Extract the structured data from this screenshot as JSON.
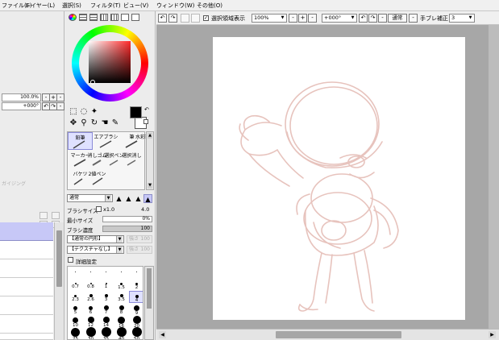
{
  "menubar": {
    "items": [
      "ファイル(F)",
      "レイヤー(L)",
      "選択(S)",
      "フィルタ(T)",
      "ビュー(V)",
      "ウィンドウ(W)",
      "その他(O)"
    ]
  },
  "left_panel": {
    "field_value_1": "100.0%",
    "field_value_2": "+000°",
    "faded_label": "ガイジング",
    "btn_minus": "-",
    "btn_plus": "+",
    "btn_reset": "-",
    "btn_rot_left": "↶",
    "btn_rot_right": "↷"
  },
  "tool_panel": {
    "main_color": "#000000",
    "sub_color": "#ffffff",
    "brush_tools": [
      {
        "label": "鉛筆",
        "selected": true
      },
      {
        "label": "エアブラシ",
        "selected": false
      },
      {
        "label": "筆",
        "selected": false
      },
      {
        "label": "水彩筆",
        "selected": false
      },
      {
        "label": "マーカー",
        "selected": false
      },
      {
        "label": "消しゴム",
        "selected": false
      },
      {
        "label": "選択ペン",
        "selected": false
      },
      {
        "label": "選択消し",
        "selected": false
      },
      {
        "label": "バケツ",
        "selected": false
      },
      {
        "label": "2値ペン",
        "selected": false
      }
    ],
    "blend_mode": "通常",
    "brush_size_label": "ブラシサイズ",
    "brush_size_multiplier": "x1.0",
    "brush_size_value": "4.0",
    "min_size_label": "最小サイズ",
    "min_size_value": "0%",
    "density_label": "ブラシ濃度",
    "density_value": "100",
    "density_fraction": 1.0,
    "shape_dropdown": "【通常の円形】",
    "texture_dropdown": "【テクスチャなし】",
    "strength_1": "100",
    "strength_2": "100",
    "strength_label": "強さ",
    "detail_label": "詳細設定",
    "preset_sizes": [
      {
        "label": ".",
        "row": 0
      },
      {
        "label": ".",
        "row": 0
      },
      {
        "label": ".",
        "row": 0
      },
      {
        "label": ".",
        "row": 0
      },
      {
        "label": ".",
        "row": 0
      },
      {
        "label": "0.7",
        "row": 1
      },
      {
        "label": "0.8",
        "row": 1
      },
      {
        "label": "1",
        "row": 1
      },
      {
        "label": "1.5",
        "row": 1
      },
      {
        "label": "2",
        "row": 1
      },
      {
        "label": "2.3",
        "row": 2
      },
      {
        "label": "2.6",
        "row": 2
      },
      {
        "label": "3",
        "row": 2
      },
      {
        "label": "3.5",
        "row": 2
      },
      {
        "label": "4",
        "row": 2
      },
      {
        "label": "5",
        "row": 3
      },
      {
        "label": "6",
        "row": 3
      },
      {
        "label": "7",
        "row": 3
      },
      {
        "label": "8",
        "row": 3
      },
      {
        "label": "9",
        "row": 3
      },
      {
        "label": "10",
        "row": 4
      },
      {
        "label": "12",
        "row": 4
      },
      {
        "label": "14",
        "row": 4
      },
      {
        "label": "16",
        "row": 4
      },
      {
        "label": "20",
        "row": 4
      },
      {
        "label": "25",
        "row": 5
      },
      {
        "label": "30",
        "row": 5
      },
      {
        "label": "35",
        "row": 5
      },
      {
        "label": "40",
        "row": 5
      },
      {
        "label": "50",
        "row": 5
      }
    ],
    "selected_preset": "4"
  },
  "canvas_toolbar": {
    "selection_visible_label": "選択領域表示",
    "selection_visible_checked": true,
    "zoom_value": "100%",
    "rotation_value": "+000°",
    "normal_button": "通常",
    "stabilizer_label": "手ブレ補正",
    "stabilizer_value": "3"
  },
  "canvas": {
    "sketch_color": "#e7c3bd",
    "background_color": "#a7a7a7"
  }
}
